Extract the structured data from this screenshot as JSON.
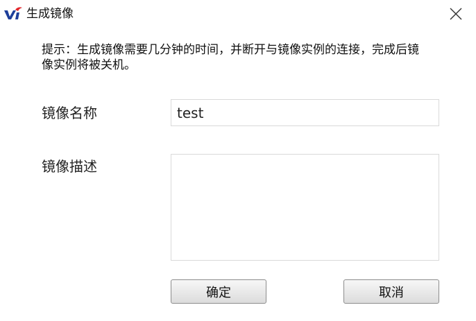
{
  "dialog": {
    "title": "生成镜像",
    "logo_icon": "vi-logo-icon",
    "close_icon": "close-icon"
  },
  "tip": "提示：生成镜像需要几分钟的时间，并断开与镜像实例的连接，完成后镜像实例将被关机。",
  "form": {
    "name_label": "镜像名称",
    "name_value": "test",
    "desc_label": "镜像描述",
    "desc_value": ""
  },
  "buttons": {
    "ok": "确定",
    "cancel": "取消"
  },
  "colors": {
    "logo_blue": "#1e3f9a",
    "logo_red": "#e3262b"
  }
}
